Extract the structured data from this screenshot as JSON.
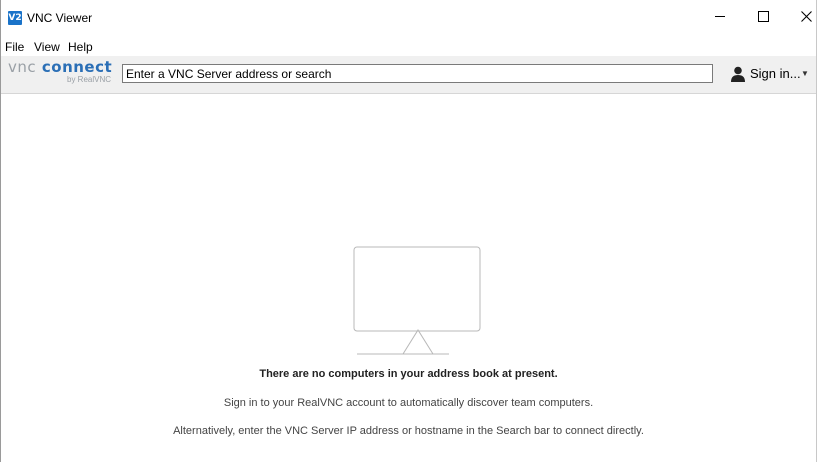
{
  "window": {
    "title": "VNC Viewer",
    "logo_text": "V2"
  },
  "menu": {
    "items": [
      "File",
      "View",
      "Help"
    ]
  },
  "toolbar": {
    "brand_vnc": "vnc",
    "brand_connect": "connect",
    "brand_sub": "by RealVNC",
    "search_placeholder": "Enter a VNC Server address or search",
    "search_value": "",
    "signin_label": "Sign in...",
    "signin_icon": "user-icon",
    "signin_caret": "▼"
  },
  "content": {
    "empty_title": "There are no computers in your address book at present.",
    "line1": "Sign in to your RealVNC account to automatically discover team computers.",
    "line2": "Alternatively, enter the VNC Server IP address or hostname in the Search bar to connect directly."
  },
  "colors": {
    "accent": "#2b6fb6",
    "brand_gray": "#9aa0a6",
    "toolbar_bg": "#f0f0f0",
    "logo_bg": "#1a73c9"
  }
}
